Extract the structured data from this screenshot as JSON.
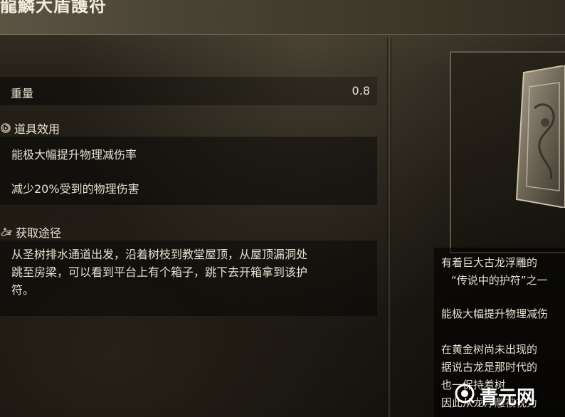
{
  "item": {
    "title": "龍鱗大盾護符"
  },
  "stats": {
    "weight_label": "重量",
    "weight_value": "0.8"
  },
  "effect": {
    "heading": "道具效用",
    "lines": [
      "能极大幅提升物理减伤率",
      "减少20%受到的物理伤害"
    ]
  },
  "acquisition": {
    "heading": "获取途径",
    "lines": [
      "从圣树排水通道出发，沿着树枝到教堂屋顶，从屋顶漏洞处",
      "跳至房梁，可以看到平台上有个箱子，跳下去开箱拿到该护",
      "符。"
    ]
  },
  "description": {
    "lines": [
      "有着巨大古龙浮雕的",
      "“传说中的护符”之一",
      "能极大幅提升物理减伤",
      "在黄金树尚未出现的",
      "据说古龙是那时代的",
      "也一保持着树",
      "因此从龙浮雕被视为"
    ]
  },
  "icons": {
    "effect": "effect-swirl-icon",
    "acquisition": "acquisition-hand-icon",
    "watermark": "watermark-logo-icon"
  },
  "watermark": {
    "text": "青元网"
  }
}
